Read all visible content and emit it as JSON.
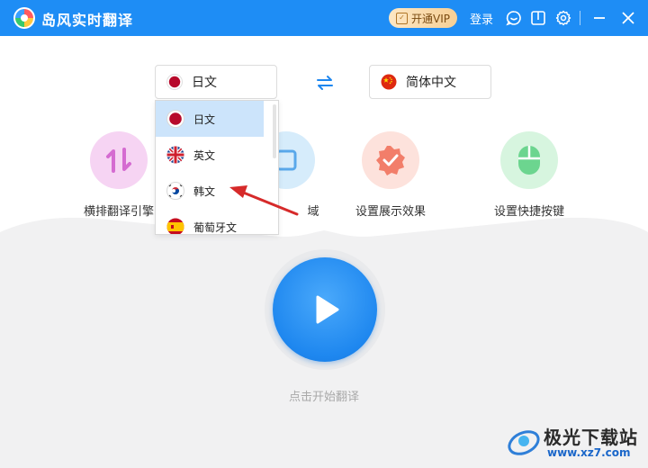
{
  "app": {
    "title": "岛风实时翻译",
    "vip_label": "开通VIP",
    "login_label": "登录"
  },
  "colors": {
    "titlebar": "#1e8df5",
    "accent": "#1e87ef",
    "dropdown_selected": "#cce4fb",
    "arrow": "#d62a2a"
  },
  "toolbar_icons": [
    "chat-icon",
    "book-icon",
    "gear-icon",
    "minimize-icon",
    "close-icon"
  ],
  "source_lang": {
    "label": "日文",
    "flag": "japan-flag-icon"
  },
  "target_lang": {
    "label": "简体中文",
    "flag": "china-flag-icon"
  },
  "dropdown": {
    "items": [
      {
        "label": "日文",
        "flag": "japan-flag-icon",
        "selected": true
      },
      {
        "label": "英文",
        "flag": "uk-flag-icon",
        "selected": false
      },
      {
        "label": "韩文",
        "flag": "korea-flag-icon",
        "selected": false
      },
      {
        "label": "葡萄牙文",
        "flag": "portugal-flag-icon",
        "selected": false
      }
    ]
  },
  "features": [
    {
      "label": "横排翻译引擎",
      "icon": "swap-vertical-icon",
      "color": "#f6d4f3"
    },
    {
      "label": "域",
      "icon": "region-icon",
      "color": "#d6ecfb"
    },
    {
      "label": "设置展示效果",
      "icon": "badge-check-icon",
      "color": "#fde2dc"
    },
    {
      "label": "设置快捷按键",
      "icon": "mouse-icon",
      "color": "#d7f5df"
    }
  ],
  "start": {
    "label": "点击开始翻译"
  },
  "watermark": {
    "name": "极光下载站",
    "url": "www.xz7.com"
  }
}
